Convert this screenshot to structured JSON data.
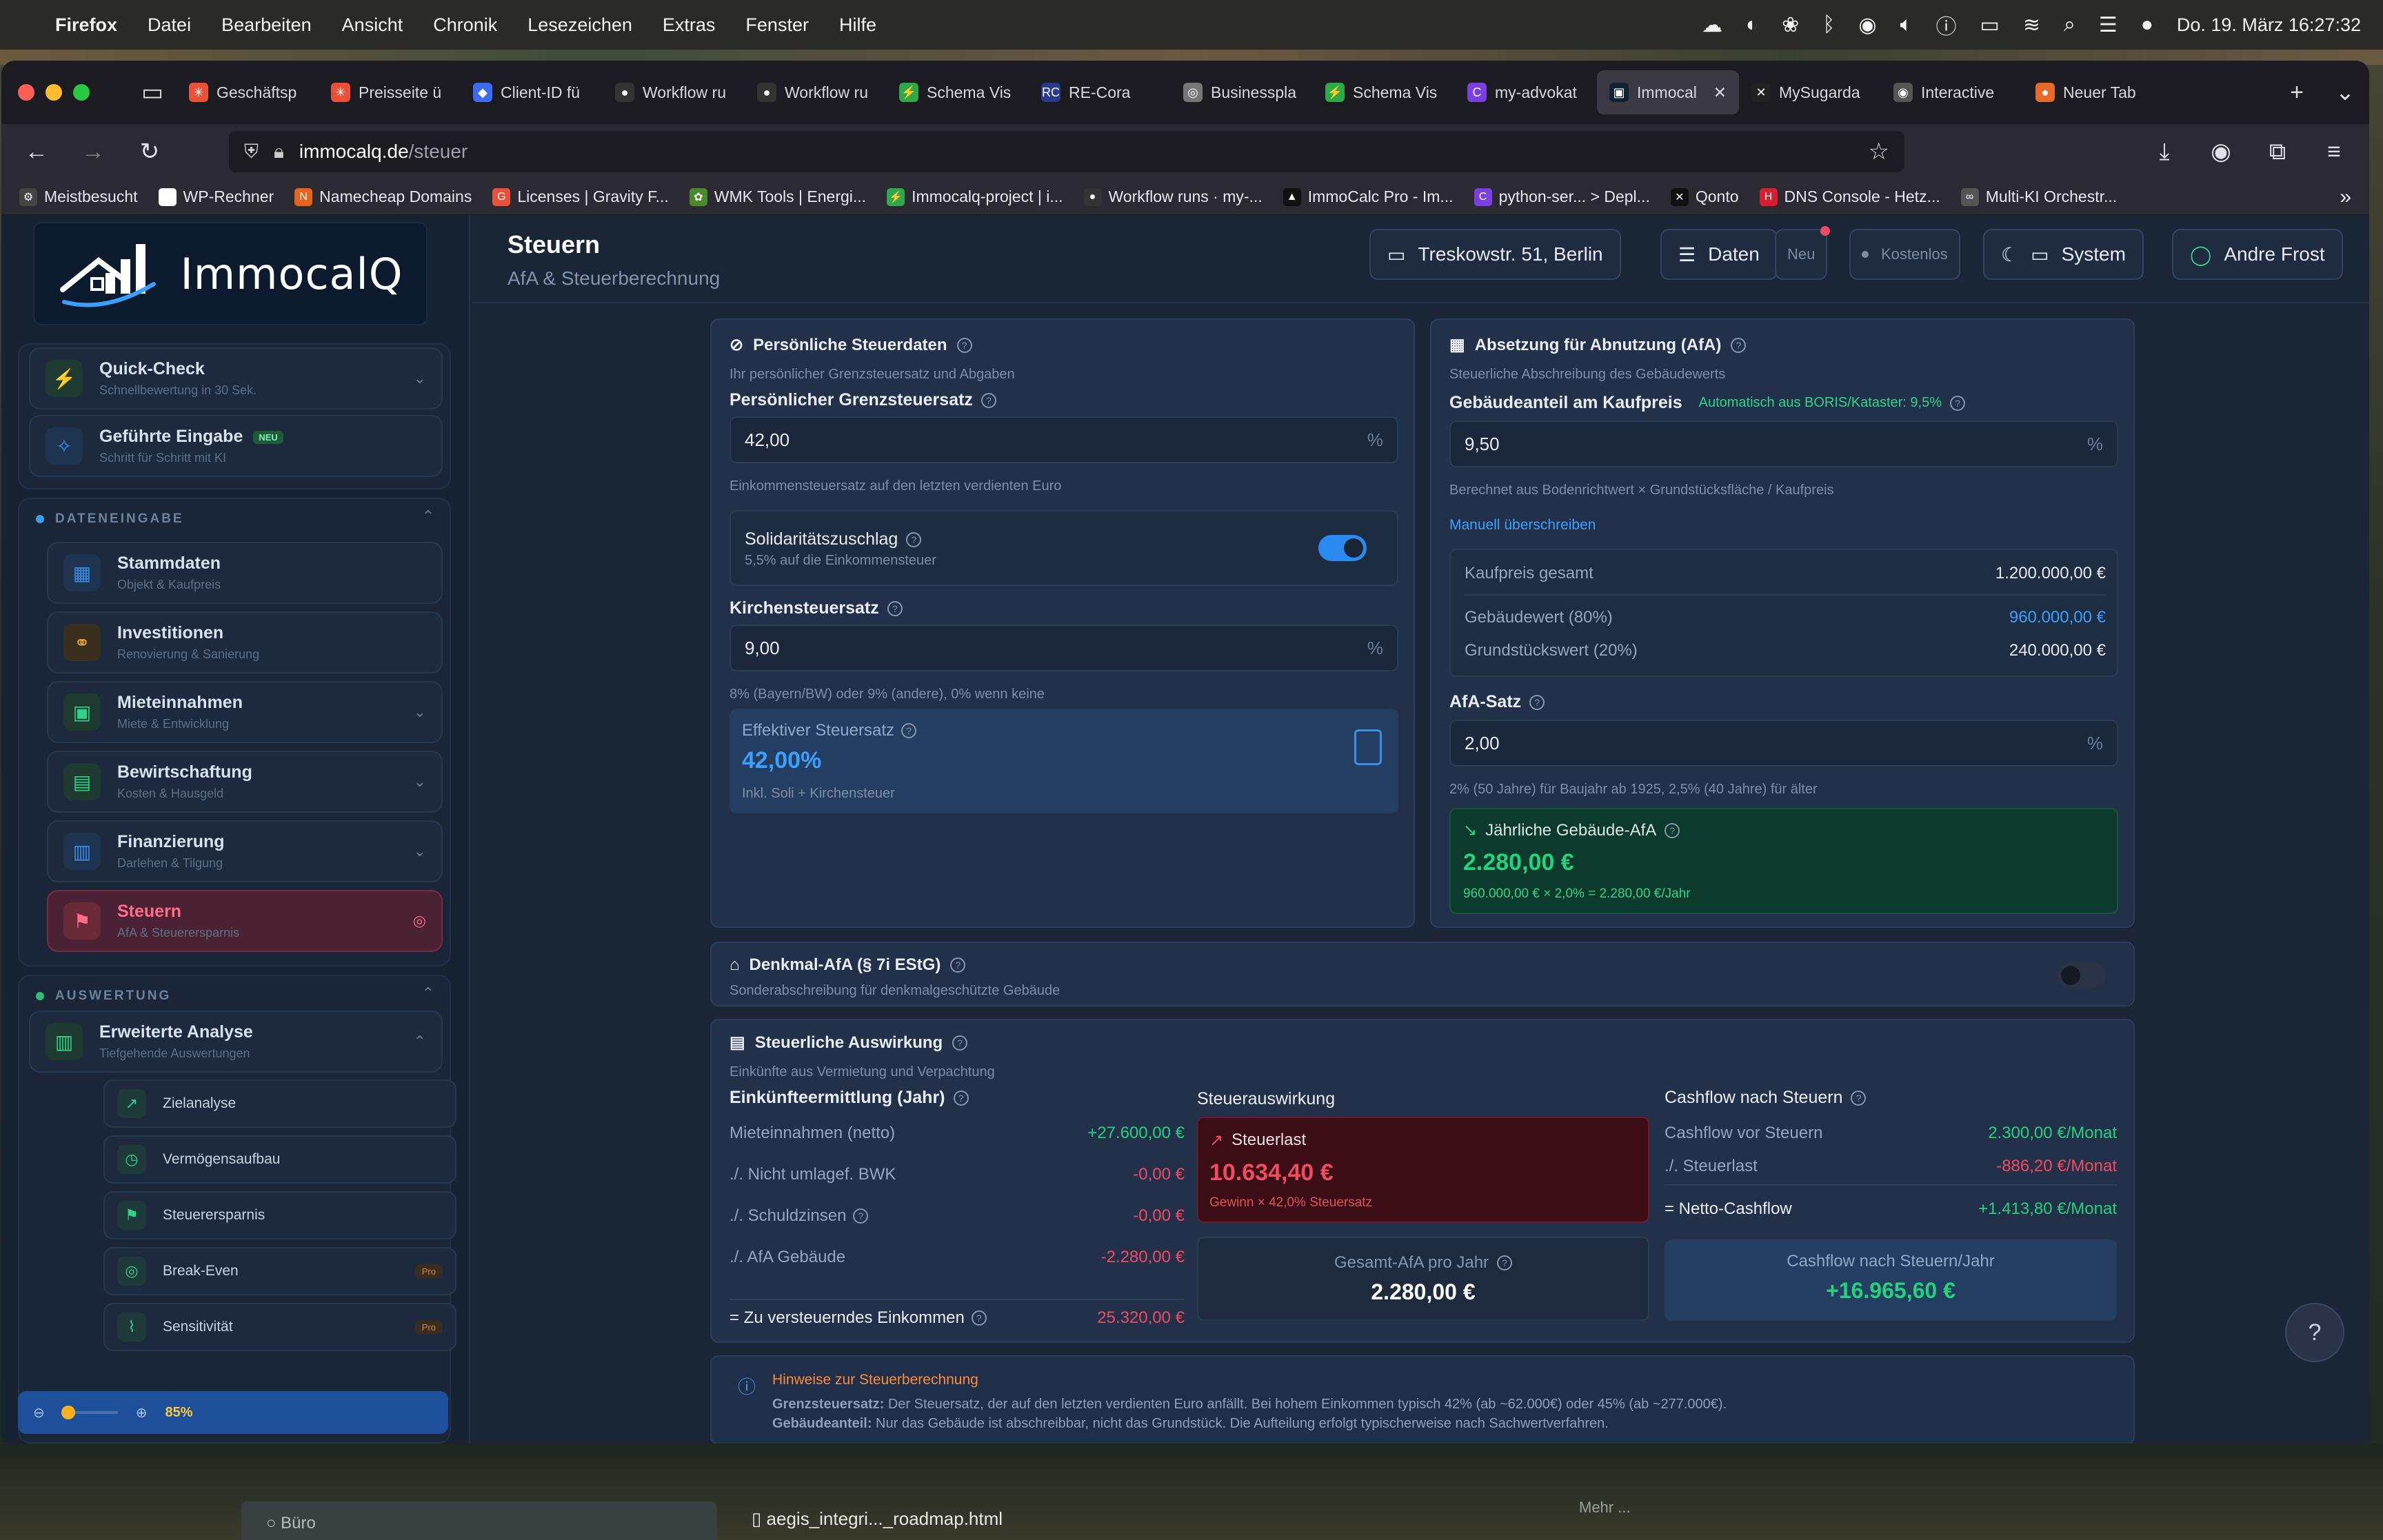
{
  "menubar": {
    "app": "Firefox",
    "items": [
      "Datei",
      "Bearbeiten",
      "Ansicht",
      "Chronik",
      "Lesezeichen",
      "Extras",
      "Fenster",
      "Hilfe"
    ],
    "clock": "Do. 19. März 16:27:32"
  },
  "browser": {
    "tabs": [
      {
        "label": "Geschäftsp",
        "color": "#e8503a",
        "glyph": "✳"
      },
      {
        "label": "Preisseite ü",
        "color": "#e8503a",
        "glyph": "✳"
      },
      {
        "label": "Client-ID fü",
        "color": "#3b6cf0",
        "glyph": "◆"
      },
      {
        "label": "Workflow ru",
        "color": "#333",
        "glyph": "●"
      },
      {
        "label": "Workflow ru",
        "color": "#333",
        "glyph": "●"
      },
      {
        "label": "Schema Vis",
        "color": "#2ea84a",
        "glyph": "⚡"
      },
      {
        "label": "RE-Cora",
        "color": "#2a3a8a",
        "glyph": "RC"
      },
      {
        "label": "Businesspla",
        "color": "#777",
        "glyph": "◎"
      },
      {
        "label": "Schema Vis",
        "color": "#2ea84a",
        "glyph": "⚡"
      },
      {
        "label": "my-advokat",
        "color": "#7b3fe0",
        "glyph": "C"
      },
      {
        "label": "Immocal",
        "color": "#123",
        "glyph": "▣"
      },
      {
        "label": "MySugarda",
        "color": "#222",
        "glyph": "✕"
      },
      {
        "label": "Interactive",
        "color": "#555",
        "glyph": "◉"
      },
      {
        "label": "Neuer Tab",
        "color": "#e66b2a",
        "glyph": "●"
      }
    ],
    "url_host": "immocalq.de",
    "url_path": "/steuer",
    "bookmarks": [
      {
        "label": "Meistbesucht",
        "color": "#444",
        "glyph": "⚙"
      },
      {
        "label": "WP-Rechner",
        "color": "#fff",
        "glyph": " "
      },
      {
        "label": "Namecheap Domains",
        "color": "#e8641e",
        "glyph": "N"
      },
      {
        "label": "Licenses | Gravity F...",
        "color": "#e8503a",
        "glyph": "G"
      },
      {
        "label": "WMK Tools | Energi...",
        "color": "#4a8a2a",
        "glyph": "✿"
      },
      {
        "label": "Immocalq-project | i...",
        "color": "#2ea84a",
        "glyph": "⚡"
      },
      {
        "label": "Workflow runs · my-...",
        "color": "#333",
        "glyph": "●"
      },
      {
        "label": "ImmoCalc Pro - Im...",
        "color": "#111",
        "glyph": "▲"
      },
      {
        "label": "python-ser... > Depl...",
        "color": "#7b3fe0",
        "glyph": "C"
      },
      {
        "label": "Qonto",
        "color": "#111",
        "glyph": "✕"
      },
      {
        "label": "DNS Console - Hetz...",
        "color": "#d81e2e",
        "glyph": "H"
      },
      {
        "label": "Multi-KI Orchestr...",
        "color": "#555",
        "glyph": "∞"
      }
    ]
  },
  "sidebar": {
    "logo": "ImmocalQ",
    "top": [
      {
        "title": "Quick-Check",
        "sub": "Schnellbewertung in 30 Sek.",
        "icon": "⚡"
      },
      {
        "title": "Geführte Eingabe",
        "badge": "NEU",
        "sub": "Schritt für Schritt mit KI",
        "icon": "✧"
      }
    ],
    "section1": "DATENEINGABE",
    "items": [
      {
        "title": "Stammdaten",
        "sub": "Objekt & Kaufpreis",
        "icon": "▦",
        "color": "#3a8ee8",
        "bg": "#1f3450"
      },
      {
        "title": "Investitionen",
        "sub": "Renovierung & Sanierung",
        "icon": "⚭",
        "color": "#e8a23a",
        "bg": "#3a2e1e"
      },
      {
        "title": "Mieteinnahmen",
        "sub": "Miete & Entwicklung",
        "icon": "▣",
        "color": "#2fd48a",
        "bg": "#1f3a30"
      },
      {
        "title": "Bewirtschaftung",
        "sub": "Kosten & Hausgeld",
        "icon": "▤",
        "color": "#2fd48a",
        "bg": "#1f3a30"
      },
      {
        "title": "Finanzierung",
        "sub": "Darlehen & Tilgung",
        "icon": "▥",
        "color": "#3a8ee8",
        "bg": "#1f3450"
      },
      {
        "title": "Steuern",
        "sub": "AfA & Steuerersparnis",
        "icon": "⚑",
        "color": "#ff6d88",
        "bg": "#6a2a3a"
      }
    ],
    "section2": "AUSWERTUNG",
    "analysis": {
      "title": "Erweiterte Analyse",
      "sub": "Tiefgehende Auswertungen",
      "icon": "▥"
    },
    "subitems": [
      {
        "title": "Zielanalyse",
        "icon": "↗"
      },
      {
        "title": "Vermögensaufbau",
        "icon": "◷"
      },
      {
        "title": "Steuerersparnis",
        "icon": "⚑"
      },
      {
        "title": "Break-Even",
        "icon": "◎",
        "pro": "Pro"
      },
      {
        "title": "Sensitivität",
        "icon": "⌇",
        "pro": "Pro"
      }
    ],
    "zoom": "85%"
  },
  "header": {
    "title": "Steuern",
    "subtitle": "AfA & Steuerberechnung",
    "address": "Treskowstr. 51, Berlin",
    "data_btn": "Daten",
    "new_btn": "Neu",
    "plan": "Kostenlos",
    "theme": "System",
    "user": "Andre Frost"
  },
  "personal": {
    "title": "Persönliche Steuerdaten",
    "subtitle": "Ihr persönlicher Grenzsteuersatz und Abgaben",
    "marginal_label": "Persönlicher Grenzsteuersatz",
    "marginal_value": "42,00",
    "unit": "%",
    "marginal_hint": "Einkommensteuersatz auf den letzten verdienten Euro",
    "soli_label": "Solidaritätszuschlag",
    "soli_sub": "5,5% auf die Einkommensteuer",
    "church_label": "Kirchensteuersatz",
    "church_value": "9,00",
    "church_hint": "8% (Bayern/BW) oder 9% (andere), 0% wenn keine",
    "eff_label": "Effektiver Steuersatz",
    "eff_value": "42,00%",
    "eff_sub": "Inkl. Soli + Kirchensteuer"
  },
  "afa": {
    "title": "Absetzung für Abnutzung (AfA)",
    "subtitle": "Steuerliche Abschreibung des Gebäudewerts",
    "share_label": "Gebäudeanteil am Kaufpreis",
    "share_auto": "Automatisch aus BORIS/Kataster: 9,5%",
    "share_value": "9,50",
    "unit": "%",
    "share_hint": "Berechnet aus Bodenrichtwert × Grundstücksfläche / Kaufpreis",
    "override": "Manuell überschreiben",
    "rows": [
      {
        "k": "Kaufpreis gesamt",
        "v": "1.200.000,00 €"
      },
      {
        "k": "Gebäudewert (80%)",
        "v": "960.000,00 €"
      },
      {
        "k": "Grundstückswert (20%)",
        "v": "240.000,00 €"
      }
    ],
    "rate_label": "AfA-Satz",
    "rate_value": "2,00",
    "rate_hint": "2% (50 Jahre) für Baujahr ab 1925, 2,5% (40 Jahre) für älter",
    "annual_label": "Jährliche Gebäude-AfA",
    "annual_value": "2.280,00 €",
    "annual_calc": "960.000,00 € × 2,0% = 2.280,00 €/Jahr"
  },
  "denkmal": {
    "title": "Denkmal-AfA (§ 7i EStG)",
    "subtitle": "Sonderabschreibung für denkmalgeschützte Gebäude"
  },
  "impact": {
    "title": "Steuerliche Auswirkung",
    "subtitle": "Einkünfte aus Vermietung und Verpachtung",
    "income_title": "Einkünfteermittlung (Jahr)",
    "income_rows": [
      {
        "k": "Mieteinnahmen (netto)",
        "v": "+27.600,00 €"
      },
      {
        "k": "./. Nicht umlagef. BWK",
        "v": "-0,00 €"
      },
      {
        "k": "./. Schuldzinsen",
        "v": "-0,00 €"
      },
      {
        "k": "./. AfA Gebäude",
        "v": "-2.280,00 €"
      }
    ],
    "taxable_label": "= Zu versteuerndes Einkommen",
    "taxable_value": "25.320,00 €",
    "effect_title": "Steuerauswirkung",
    "burden_label": "Steuerlast",
    "burden_value": "10.634,40 €",
    "burden_sub": "Gewinn × 42,0% Steuersatz",
    "total_afa_label": "Gesamt-AfA pro Jahr",
    "total_afa_value": "2.280,00 €",
    "cf_title": "Cashflow nach Steuern",
    "cf_rows": [
      {
        "k": "Cashflow vor Steuern",
        "v": "2.300,00 €/Monat"
      },
      {
        "k": "./. Steuerlast",
        "v": "-886,20 €/Monat"
      },
      {
        "k": "= Netto-Cashflow",
        "v": "+1.413,80 €/Monat"
      }
    ],
    "cf_year_label": "Cashflow nach Steuern/Jahr",
    "cf_year_value": "+16.965,60 €"
  },
  "hints": {
    "title": "Hinweise zur Steuerberechnung",
    "line1_b": "Grenzsteuersatz:",
    "line1": " Der Steuersatz, der auf den letzten verdienten Euro anfällt. Bei hohem Einkommen typisch 42% (ab ~62.000€) oder 45% (ab ~277.000€).",
    "line2_b": "Gebäudeanteil:",
    "line2": " Nur das Gebäude ist abschreibbar, nicht das Grundstück. Die Aufteilung erfolgt typischerweise nach Sachwertverfahren."
  },
  "help": "?",
  "taskbar": {
    "left": "Büro",
    "file": "aegis_integri..._roadmap.html",
    "mid": "Mehr ..."
  },
  "colors": {
    "accent": "#3aa0ff",
    "green": "#23d27c",
    "red": "#f04b5f",
    "active": "#ff6d88"
  }
}
